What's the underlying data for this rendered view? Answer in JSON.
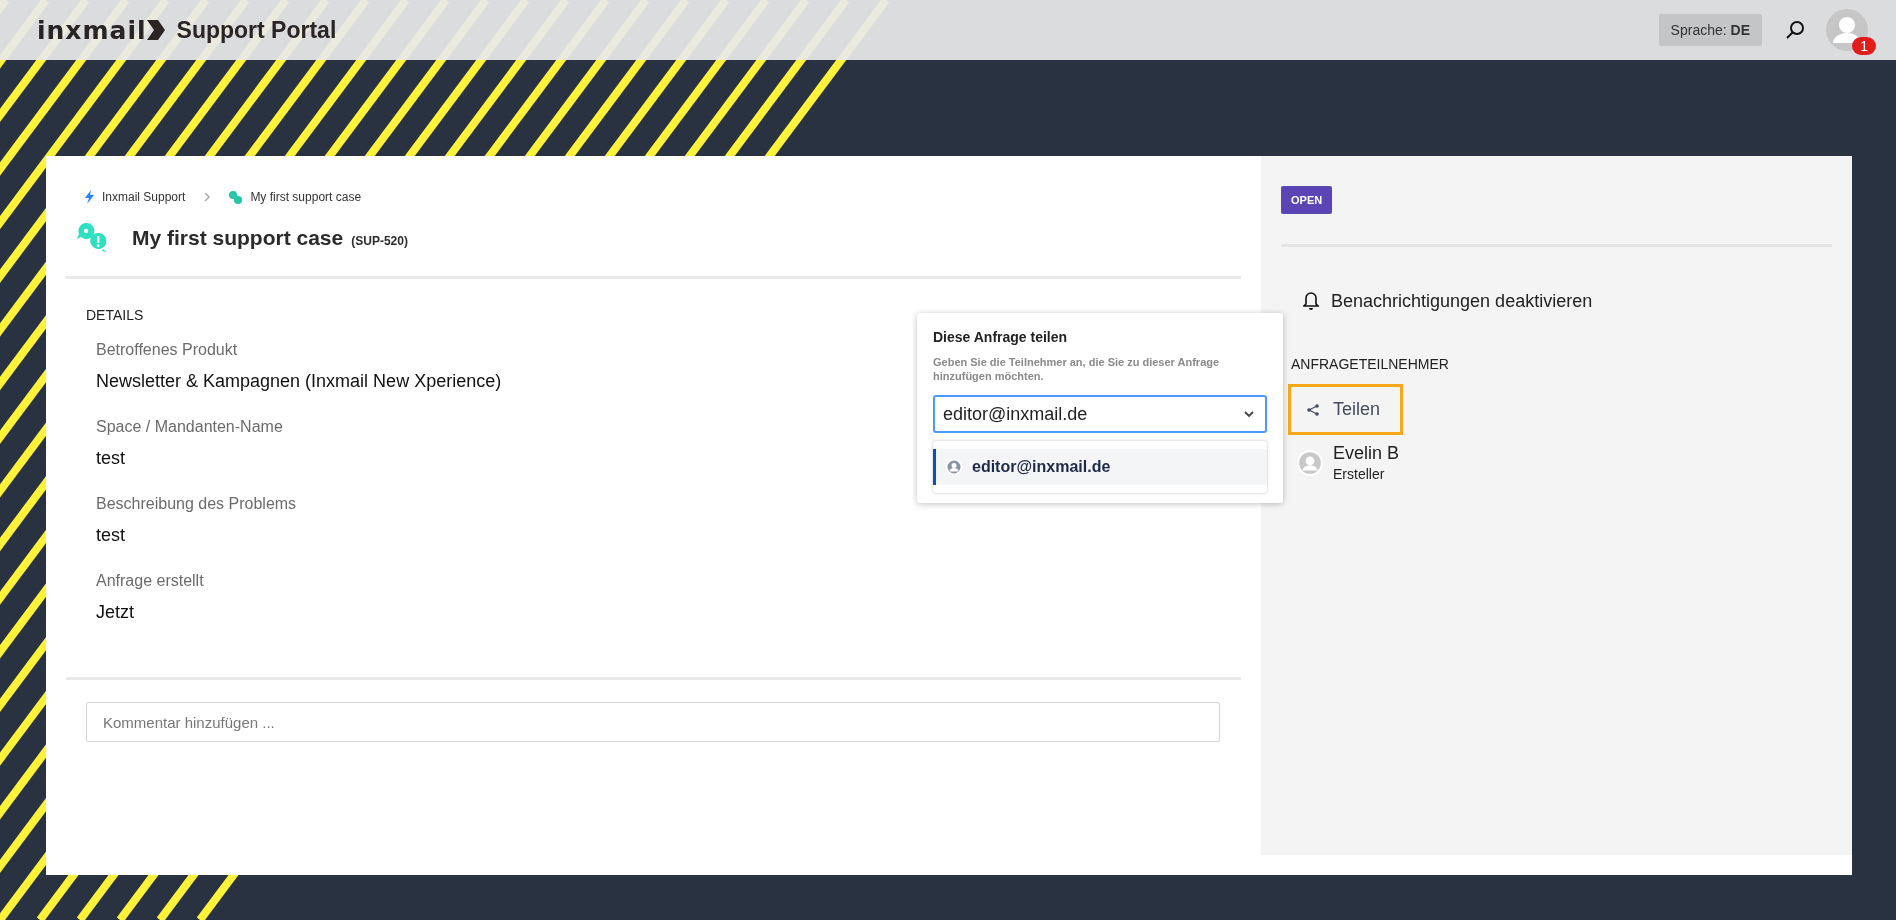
{
  "header": {
    "logo_text": "inxmail",
    "title": "Support Portal",
    "language": {
      "label": "Sprache:",
      "value": "DE"
    },
    "notification_count": "1"
  },
  "breadcrumb": [
    {
      "label": "Inxmail Support",
      "kind": "home"
    },
    {
      "label": "My first support case",
      "kind": "case"
    }
  ],
  "case": {
    "title": "My first support case",
    "key": "(SUP-520)"
  },
  "details": {
    "heading": "DETAILS",
    "fields": [
      {
        "label": "Betroffenes Produkt",
        "value": "Newsletter & Kampagnen (Inxmail New Xperience)"
      },
      {
        "label": "Space / Mandanten-Name",
        "value": "test"
      },
      {
        "label": "Beschreibung des Problems",
        "value": "test"
      },
      {
        "label": "Anfrage erstellt",
        "value": "Jetzt"
      }
    ]
  },
  "comment": {
    "placeholder": "Kommentar hinzufügen ..."
  },
  "share_popover": {
    "title": "Diese Anfrage teilen",
    "hint": "Geben Sie die Teilnehmer an, die Sie zu dieser Anfrage hinzufügen möchten.",
    "input_value": "editor@inxmail.de",
    "options": [
      {
        "label": "editor@inxmail.de",
        "selected": true
      }
    ]
  },
  "sidebar": {
    "status": "OPEN",
    "notification_action": "Benachrichtigungen deaktivieren",
    "participants_heading": "ANFRAGETEILNEHMER",
    "share_button": {
      "label": "Teilen",
      "highlighted": true
    },
    "participants": [
      {
        "name": "Evelin B",
        "role": "Ersteller"
      }
    ]
  }
}
